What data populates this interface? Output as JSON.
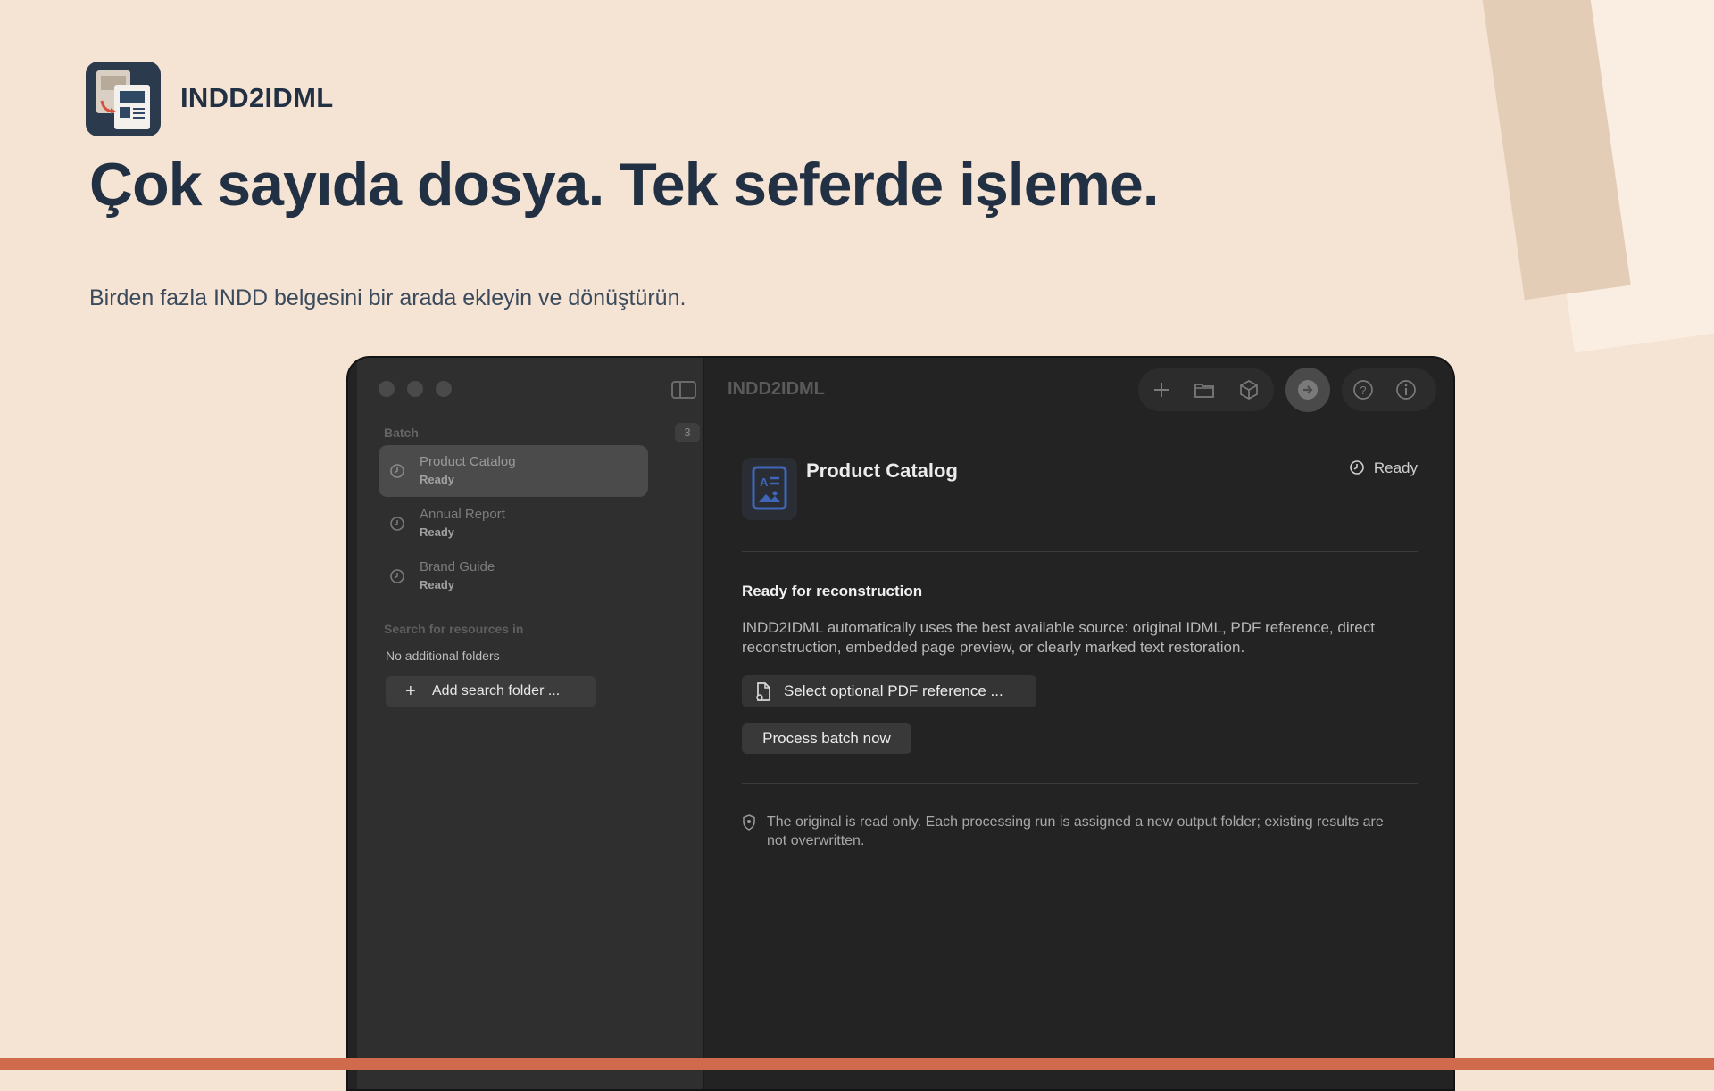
{
  "brand": {
    "name": "INDD2IDML"
  },
  "hero": {
    "headline": "Çok sayıda dosya. Tek seferde işleme.",
    "subline": "Birden fazla INDD belgesini bir arada ekleyin ve dönüştürün."
  },
  "colors": {
    "background": "#f5e4d4",
    "accent_bar": "#cf6a4c",
    "window": "#232323",
    "sidebar": "#2f2f2f"
  },
  "window": {
    "title": "INDD2IDML",
    "toolbar_icons": [
      "plus-icon",
      "folder-icon",
      "box-icon",
      "run-icon",
      "help-icon",
      "info-icon"
    ]
  },
  "sidebar": {
    "batch_label": "Batch",
    "batch_count": "3",
    "items": [
      {
        "name": "Product Catalog",
        "status": "Ready",
        "selected": true
      },
      {
        "name": "Annual Report",
        "status": "Ready",
        "selected": false
      },
      {
        "name": "Brand Guide",
        "status": "Ready",
        "selected": false
      }
    ],
    "search_label": "Search for resources in",
    "no_folders": "No additional folders",
    "add_folder_button": "Add search folder ..."
  },
  "detail": {
    "title": "Product Catalog",
    "status": "Ready",
    "section_title": "Ready for reconstruction",
    "description": "INDD2IDML automatically uses the best available source: original IDML, PDF reference, direct reconstruction, embedded page preview, or clearly marked text restoration.",
    "pdf_button": "Select optional PDF reference ...",
    "process_button": "Process batch now",
    "note": "The original is read only. Each processing run is assigned a new output folder; existing results are not overwritten."
  }
}
